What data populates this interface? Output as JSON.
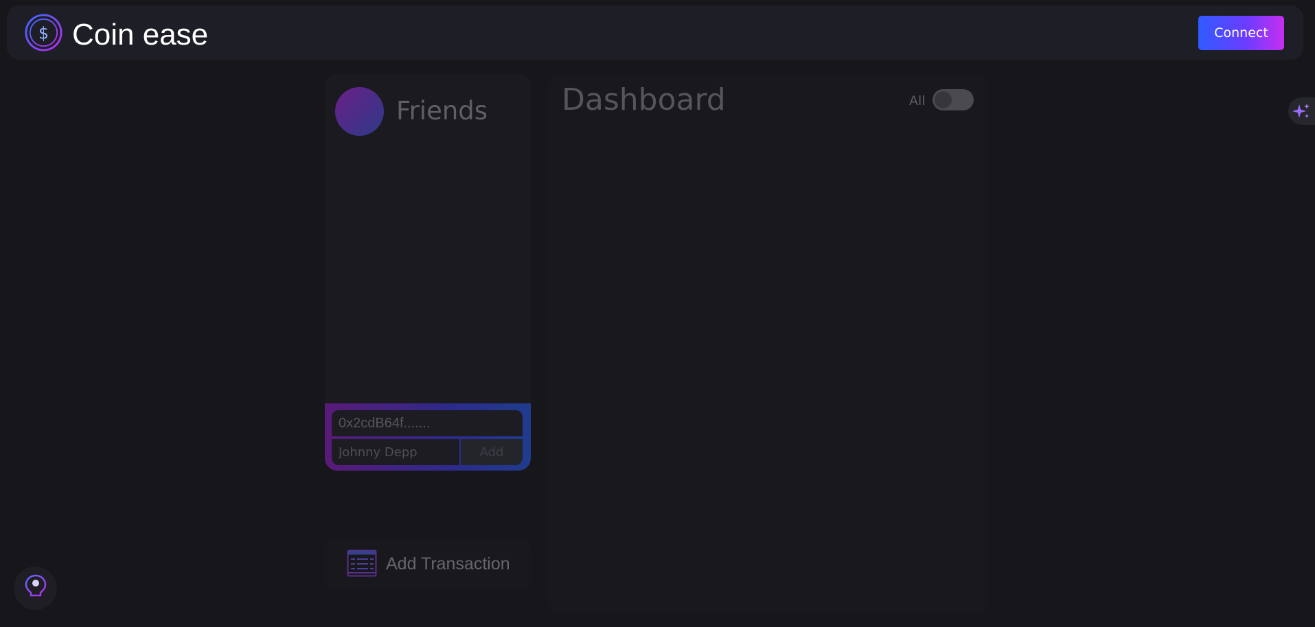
{
  "header": {
    "app_title": "Coin ease",
    "logo_icon": "dollar-coin-icon",
    "connect_label": "Connect"
  },
  "friends": {
    "title": "Friends",
    "address_placeholder": "0x2cdB64f.......",
    "name_placeholder": "Johnny Depp",
    "add_label": "Add"
  },
  "actions": {
    "add_transaction_label": "Add Transaction",
    "add_transaction_icon": "ledger-icon"
  },
  "dashboard": {
    "title": "Dashboard",
    "toggle_label": "All",
    "toggle_on": false
  },
  "floating": {
    "sparkle_icon": "sparkle-icon",
    "tips_icon": "lightbulb-icon"
  },
  "colors": {
    "background": "#16161b",
    "navbar": "#1e1e27",
    "accent_blue": "#2f5bff",
    "accent_purple": "#c62ff0"
  }
}
